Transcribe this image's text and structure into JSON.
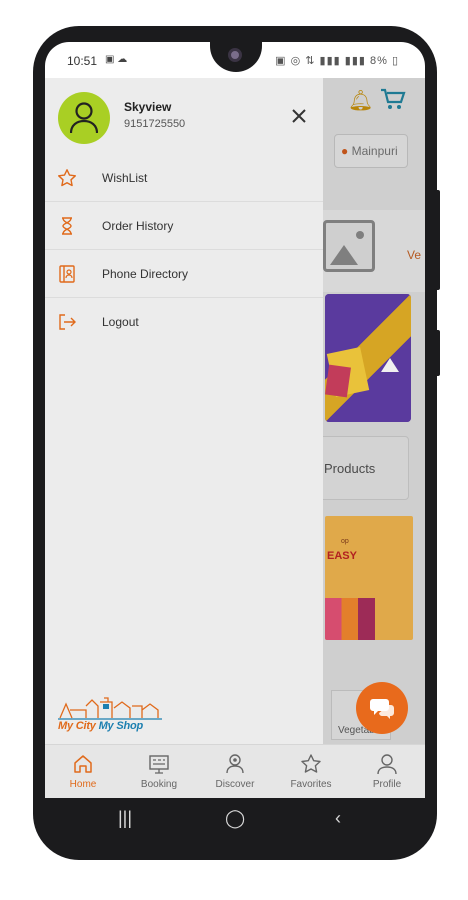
{
  "status_bar": {
    "time": "10:51",
    "battery": "8%"
  },
  "drawer": {
    "user": {
      "name": "Skyview",
      "phone": "9151725550"
    },
    "menu_items": [
      {
        "label": "WishList",
        "icon": "star-icon"
      },
      {
        "label": "Order History",
        "icon": "hourglass-icon"
      },
      {
        "label": "Phone Directory",
        "icon": "phone-directory-icon"
      },
      {
        "label": "Logout",
        "icon": "logout-icon"
      }
    ],
    "brand": {
      "part1": "My City",
      "part2": "My Shop"
    }
  },
  "background_app": {
    "location": "Mainpuri",
    "products_label": "Products",
    "vegetable_label": "Vegetable",
    "partial_label": "Ve",
    "banner_text_small": "op",
    "banner_text_large": "EASY"
  },
  "bottom_nav": [
    {
      "label": "Home",
      "icon": "home-icon",
      "active": true
    },
    {
      "label": "Booking",
      "icon": "booking-icon",
      "active": false
    },
    {
      "label": "Discover",
      "icon": "discover-icon",
      "active": false
    },
    {
      "label": "Favorites",
      "icon": "star-icon",
      "active": false
    },
    {
      "label": "Profile",
      "icon": "profile-icon",
      "active": false
    }
  ],
  "colors": {
    "accent": "#e06a1b",
    "avatar_bg": "#a9cf24",
    "drawer_bg": "#ececec",
    "brand_blue": "#1c7fb0"
  }
}
